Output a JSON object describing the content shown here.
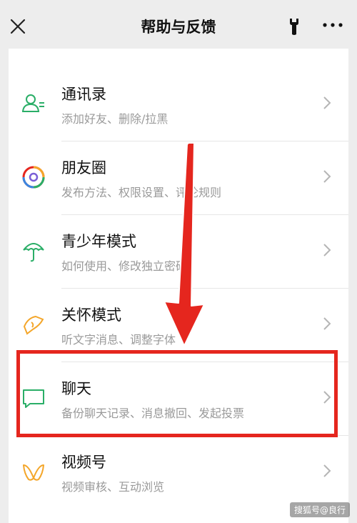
{
  "header": {
    "title": "帮助与反馈"
  },
  "items": [
    {
      "label": "通讯录",
      "desc": "添加好友、删除/拉黑",
      "icon": "contacts-icon"
    },
    {
      "label": "朋友圈",
      "desc": "发布方法、权限设置、评论规则",
      "icon": "moments-icon"
    },
    {
      "label": "青少年模式",
      "desc": "如何使用、修改独立密码",
      "icon": "umbrella-icon"
    },
    {
      "label": "关怀模式",
      "desc": "听文字消息、调整字体",
      "icon": "care-hand-icon"
    },
    {
      "label": "聊天",
      "desc": "备份聊天记录、消息撤回、发起投票",
      "icon": "chat-bubble-icon"
    },
    {
      "label": "视频号",
      "desc": "视频审核、互动浏览",
      "icon": "channels-icon"
    }
  ],
  "colors": {
    "accent_green": "#2aae67",
    "highlight_red": "#e5261e"
  },
  "watermark": "搜狐号@良行"
}
